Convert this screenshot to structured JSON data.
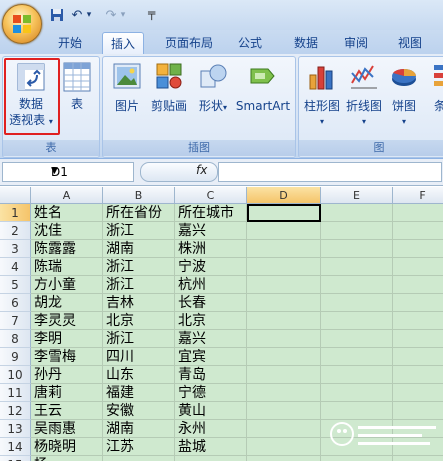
{
  "tabs": [
    "开始",
    "插入",
    "页面布局",
    "公式",
    "数据",
    "审阅",
    "视图"
  ],
  "active_tab": "插入",
  "ribbon": {
    "pivot_label_line1": "数据",
    "pivot_label_line2": "透视表",
    "table_label": "表",
    "group_table": "表",
    "picture_label": "图片",
    "clipart_label": "剪贴画",
    "shapes_label": "形状",
    "smartart_label": "SmartArt",
    "group_illustrations": "插图",
    "bar_chart_label": "柱形图",
    "line_chart_label": "折线图",
    "pie_chart_label": "饼图",
    "more_chart_label": "条",
    "group_charts": "图"
  },
  "formula_bar": {
    "name_box": "D1",
    "fx_label": "fx",
    "formula": ""
  },
  "columns": [
    "A",
    "B",
    "C",
    "D",
    "E",
    "F"
  ],
  "selected_column": "D",
  "selected_row": "1",
  "rows": [
    {
      "n": "1",
      "a": "姓名",
      "b": "所在省份",
      "c": "所在城市"
    },
    {
      "n": "2",
      "a": "沈佳",
      "b": "浙江",
      "c": "嘉兴"
    },
    {
      "n": "3",
      "a": "陈露露",
      "b": "湖南",
      "c": "株洲"
    },
    {
      "n": "4",
      "a": "陈瑞",
      "b": "浙江",
      "c": "宁波"
    },
    {
      "n": "5",
      "a": "方小童",
      "b": "浙江",
      "c": "杭州"
    },
    {
      "n": "6",
      "a": "胡龙",
      "b": "吉林",
      "c": "长春"
    },
    {
      "n": "7",
      "a": "李灵灵",
      "b": "北京",
      "c": "北京"
    },
    {
      "n": "8",
      "a": "李明",
      "b": "浙江",
      "c": "嘉兴"
    },
    {
      "n": "9",
      "a": "李雪梅",
      "b": "四川",
      "c": "宜宾"
    },
    {
      "n": "10",
      "a": "孙丹",
      "b": "山东",
      "c": "青岛"
    },
    {
      "n": "11",
      "a": "唐莉",
      "b": "福建",
      "c": "宁德"
    },
    {
      "n": "12",
      "a": "王云",
      "b": "安徽",
      "c": "黄山"
    },
    {
      "n": "13",
      "a": "吴雨惠",
      "b": "湖南",
      "c": "永州"
    },
    {
      "n": "14",
      "a": "杨晓明",
      "b": "江苏",
      "c": "盐城"
    },
    {
      "n": "15",
      "a": "杨",
      "b": "",
      "c": ""
    }
  ]
}
